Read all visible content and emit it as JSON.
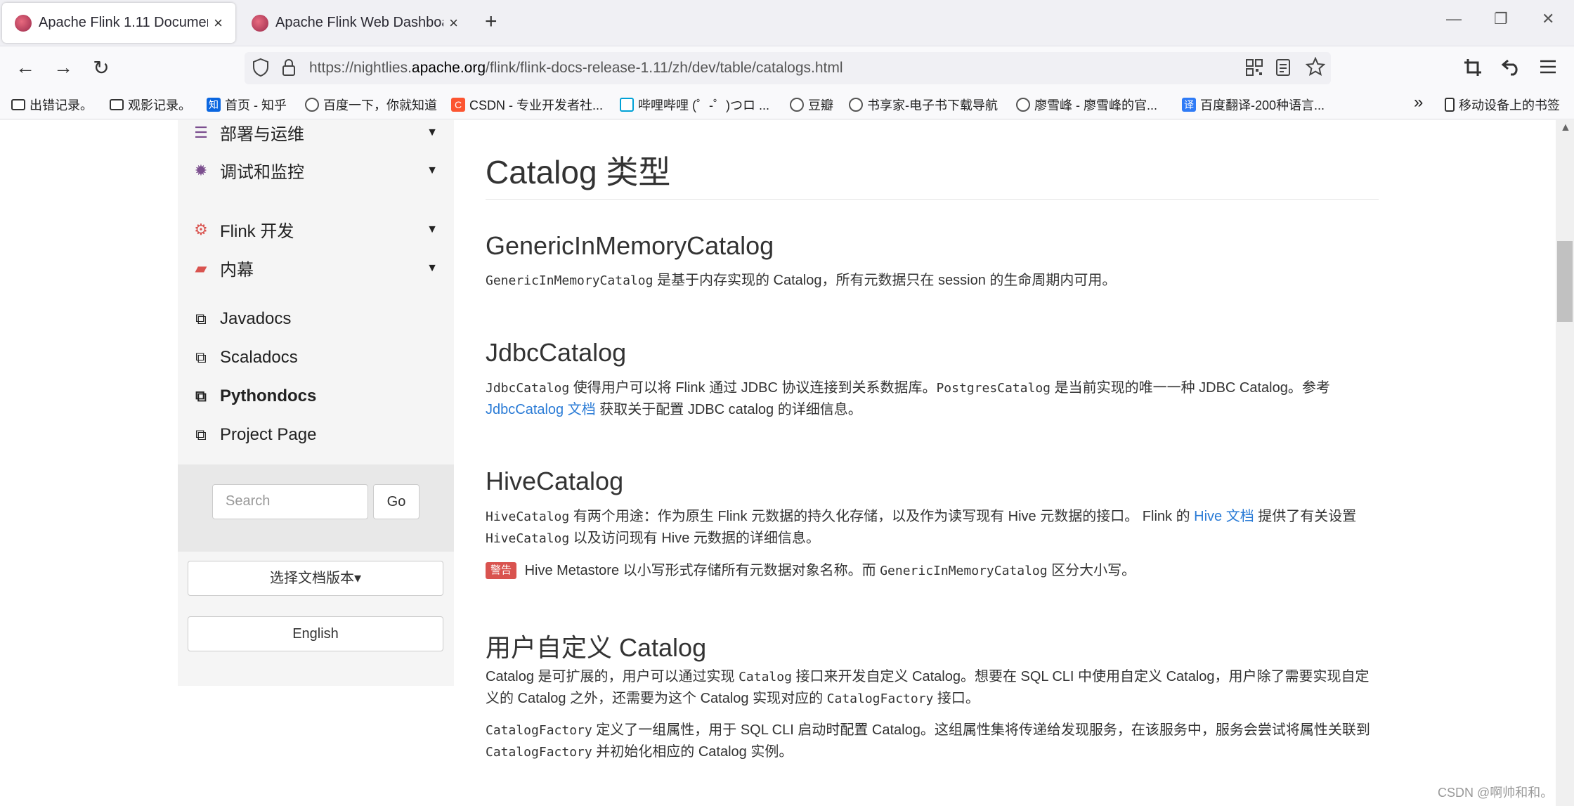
{
  "tabs": [
    {
      "title": "Apache Flink 1.11 Documentation",
      "close": "×"
    },
    {
      "title": "Apache Flink Web Dashboard",
      "close": "×"
    }
  ],
  "new_tab": "+",
  "window_controls": {
    "minimize": "—",
    "restore": "❐",
    "close": "✕"
  },
  "nav": {
    "back": "←",
    "forward": "→",
    "reload": "↻"
  },
  "url": {
    "prefix": "https://nightlies.",
    "domain": "apache.org",
    "path": "/flink/flink-docs-release-1.11/zh/dev/table/catalogs.html"
  },
  "bookmarks": [
    {
      "label": "出错记录。"
    },
    {
      "label": "观影记录。"
    },
    {
      "label": "首页 - 知乎",
      "icon": "知"
    },
    {
      "label": "百度一下，你就知道"
    },
    {
      "label": "CSDN - 专业开发者社...",
      "icon": "C"
    },
    {
      "label": "哔哩哔哩 (゜-゜)つロ ..."
    },
    {
      "label": "豆瓣"
    },
    {
      "label": "书享家-电子书下载导航"
    },
    {
      "label": "廖雪峰 - 廖雪峰的官..."
    },
    {
      "label": "百度翻译-200种语言...",
      "icon": "译"
    }
  ],
  "bookmarks_overflow": "»",
  "mobile_bookmarks": "移动设备上的书签",
  "sidebar": {
    "items": [
      {
        "label": "部署与运维",
        "icon": "sliders-icon"
      },
      {
        "label": "调试和监控",
        "icon": "bug-icon"
      },
      {
        "label": "Flink 开发",
        "icon": "gears-icon"
      },
      {
        "label": "内幕",
        "icon": "book-icon"
      }
    ],
    "links": [
      {
        "label": "Javadocs"
      },
      {
        "label": "Scaladocs"
      },
      {
        "label": "Pythondocs"
      },
      {
        "label": "Project Page"
      }
    ],
    "search_placeholder": "Search",
    "go": "Go",
    "version_button": "选择文档版本▾",
    "language_button": "English"
  },
  "content": {
    "h1": "Catalog 类型",
    "generic": {
      "title": "GenericInMemoryCatalog",
      "code": "GenericInMemoryCatalog",
      "text": " 是基于内存实现的 Catalog，所有元数据只在 session 的生命周期内可用。"
    },
    "jdbc": {
      "title": "JdbcCatalog",
      "code1": "JdbcCatalog",
      "text1": " 使得用户可以将 Flink 通过 JDBC 协议连接到关系数据库。",
      "code2": "PostgresCatalog",
      "text2": " 是当前实现的唯一一种 JDBC Catalog。参考",
      "link": "JdbcCatalog 文档",
      "text3": " 获取关于配置 JDBC catalog 的详细信息。"
    },
    "hive": {
      "title": "HiveCatalog",
      "code1": "HiveCatalog",
      "text1": " 有两个用途：作为原生 Flink 元数据的持久化存储，以及作为读写现有 Hive 元数据的接口。 Flink 的 ",
      "link": "Hive 文档",
      "text2": " 提供了有关设置 ",
      "code2": "HiveCatalog",
      "text3": " 以及访问现有 Hive 元数据的详细信息。",
      "warn_badge": "警告",
      "warn_text1": " Hive Metastore 以小写形式存储所有元数据对象名称。而 ",
      "warn_code": "GenericInMemoryCatalog",
      "warn_text2": " 区分大小写。"
    },
    "custom": {
      "title": "用户自定义 Catalog",
      "p1a": "Catalog 是可扩展的，用户可以通过实现 ",
      "p1code": "Catalog",
      "p1b": " 接口来开发自定义 Catalog。想要在 SQL CLI 中使用自定义 Catalog，用户除了需要实现自定义的 Catalog 之外，还需要为这个 Catalog 实现对应的 ",
      "p1code2": "CatalogFactory",
      "p1c": " 接口。",
      "p2code": "CatalogFactory",
      "p2a": " 定义了一组属性，用于 SQL CLI 启动时配置 Catalog。这组属性集将传递给发现服务，在该服务中，服务会尝试将属性关联到 ",
      "p2code2": "CatalogFactory",
      "p2b": " 并初始化相应的 Catalog 实例。"
    }
  },
  "watermark": "CSDN @啊帅和和。"
}
